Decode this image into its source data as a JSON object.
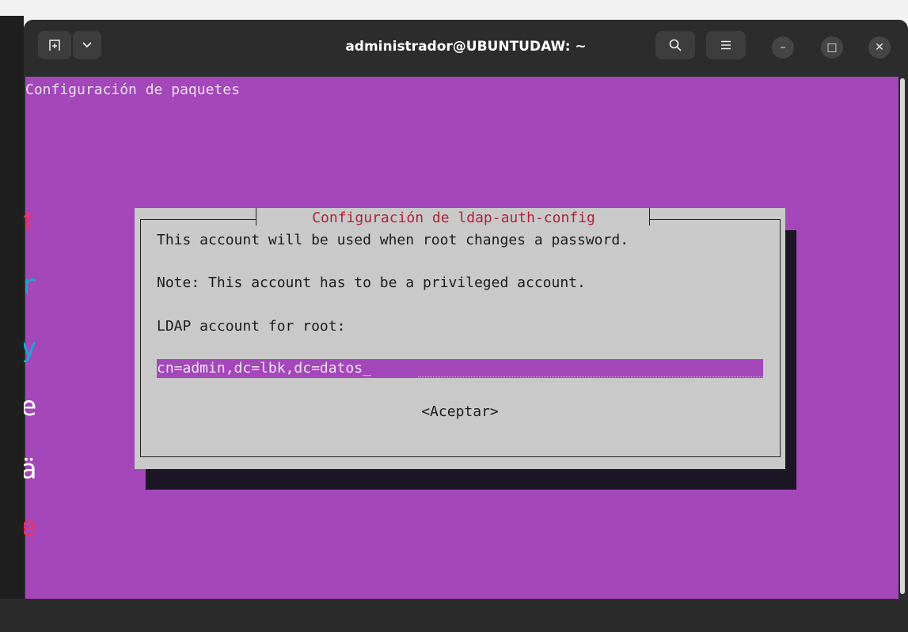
{
  "window": {
    "title": "administrador@UBUNTUDAW: ~",
    "buttons": {
      "new_tab": "new-tab-icon",
      "dropdown": "chevron-down-icon",
      "search": "search-icon",
      "menu": "hamburger-menu-icon",
      "minimize": "–",
      "maximize": "□",
      "close": "✕"
    }
  },
  "terminal": {
    "header": "Configuración de paquetes",
    "background": "#a347ba",
    "edge_glyphs": [
      {
        "text": "t",
        "color": "#e8336d"
      },
      {
        "text": "r",
        "color": "#1aa7d6"
      },
      {
        "text": "y",
        "color": "#1aa7d6"
      },
      {
        "text": "e",
        "color": "#ffffff"
      },
      {
        "text": "ä",
        "color": "#ffffff"
      },
      {
        "text": "e",
        "color": "#e8336d"
      }
    ]
  },
  "dialog": {
    "title": "Configuración de ldap-auth-config",
    "lines": [
      "This account will be used when root changes a password.",
      "Note: This account has to be a privileged account.",
      "LDAP account for root:"
    ],
    "input_value": "cn=admin,dc=lbk,dc=datos_",
    "ok_label": "<Aceptar>",
    "title_color": "#b0213a"
  }
}
